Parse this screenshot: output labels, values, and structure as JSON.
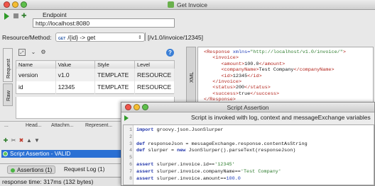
{
  "window": {
    "title": "Get Invoice"
  },
  "request": {
    "endpoint_label": "Endpoint",
    "endpoint_value": "http://localhost:8080",
    "resource_method_label": "Resource/Method:",
    "method_badge": "GET",
    "method_value": "/{id} -> get",
    "path": "[/v1.0/invoice/12345]",
    "side_tabs": [
      "Request",
      "Raw"
    ],
    "params": {
      "columns": [
        "Name",
        "Value",
        "Style",
        "Level"
      ],
      "rows": [
        [
          "version",
          "v1.0",
          "TEMPLATE",
          "RESOURCE"
        ],
        [
          "id",
          "12345",
          "TEMPLATE",
          "RESOURCE"
        ]
      ]
    },
    "bottom_tabs": [
      "...",
      "Head...",
      "Attachm...",
      "Represent..."
    ]
  },
  "assertions": {
    "items": [
      {
        "label": "Script Assertion - VALID",
        "status_color": "#5ec257"
      }
    ],
    "tabs": {
      "assertions": "Assertions (1)",
      "log": "Request Log (1)"
    }
  },
  "status": {
    "text": "response time: 317ms (132 bytes)"
  },
  "response": {
    "side_tab": "XML",
    "xml_lines": [
      {
        "parts": [
          [
            "t",
            "<Response "
          ],
          [
            "a",
            "xmlns="
          ],
          [
            "v",
            "\"http://localhost/v1.0/invoice/\""
          ],
          [
            "t",
            ">"
          ]
        ]
      },
      {
        "parts": [
          [
            "t",
            "   <invoice>"
          ]
        ]
      },
      {
        "parts": [
          [
            "t",
            "      <amount>"
          ],
          [
            "x",
            "100.0"
          ],
          [
            "t",
            "</amount>"
          ]
        ]
      },
      {
        "parts": [
          [
            "t",
            "      <companyName>"
          ],
          [
            "x",
            "Test Company"
          ],
          [
            "t",
            "</companyName>"
          ]
        ]
      },
      {
        "parts": [
          [
            "t",
            "      <id>"
          ],
          [
            "x",
            "12345"
          ],
          [
            "t",
            "</id>"
          ]
        ]
      },
      {
        "parts": [
          [
            "t",
            "   </invoice>"
          ]
        ]
      },
      {
        "parts": [
          [
            "t",
            "   <status>"
          ],
          [
            "x",
            "200"
          ],
          [
            "t",
            "</status>"
          ]
        ]
      },
      {
        "parts": [
          [
            "t",
            "   <success>"
          ],
          [
            "x",
            "true"
          ],
          [
            "t",
            "</success>"
          ]
        ]
      },
      {
        "parts": [
          [
            "t",
            "</Response>"
          ]
        ]
      }
    ]
  },
  "script_dialog": {
    "title": "Script Assertion",
    "info": "Script is invoked with log, context and messageExchange variables",
    "lines": [
      {
        "n": "1",
        "code": "import groovy.json.JsonSlurper"
      },
      {
        "n": "2",
        "code": ""
      },
      {
        "n": "3",
        "code": "def responseJson = messageExchange.response.contentAsString"
      },
      {
        "n": "4",
        "code": "def slurper = new JsonSlurper().parseText(responseJson)"
      },
      {
        "n": "5",
        "code": ""
      },
      {
        "n": "6",
        "code": "assert slurper.invoice.id=='12345'"
      },
      {
        "n": "7",
        "code": "assert slurper.invoice.companyName=='Test Company'"
      },
      {
        "n": "8",
        "code": "assert slurper.invoice.amount==100.0"
      }
    ]
  }
}
